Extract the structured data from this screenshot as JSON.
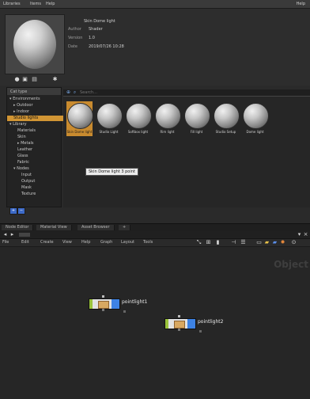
{
  "menu": [
    "Libraries",
    "Items",
    "Help"
  ],
  "menu_right": "Help",
  "info": {
    "title": "Skin Dome light",
    "rows": [
      {
        "k": "Author",
        "v": "Shader"
      },
      {
        "k": "Version",
        "v": "1.0"
      },
      {
        "k": "Date",
        "v": "2019/07/26 10:28"
      }
    ]
  },
  "left_panel": {
    "header": "Cat type",
    "items": [
      {
        "label": "Environments",
        "mk": "▾",
        "indent": 0,
        "selected": false
      },
      {
        "label": "Outdoor",
        "mk": "▸",
        "indent": 1,
        "selected": false
      },
      {
        "label": "Indoor",
        "mk": "▸",
        "indent": 1,
        "selected": false
      },
      {
        "label": "Studio lights",
        "mk": "",
        "indent": 1,
        "selected": true
      },
      {
        "label": "Library",
        "mk": "▾",
        "indent": 0,
        "selected": false
      },
      {
        "label": "Materials",
        "mk": "",
        "indent": 2,
        "selected": false
      },
      {
        "label": "Skin",
        "mk": "",
        "indent": 2,
        "selected": false
      },
      {
        "label": "Metals",
        "mk": "▸",
        "indent": 2,
        "selected": false
      },
      {
        "label": "Leather",
        "mk": "",
        "indent": 2,
        "selected": false
      },
      {
        "label": "Glass",
        "mk": "",
        "indent": 2,
        "selected": false
      },
      {
        "label": "Fabric",
        "mk": "",
        "indent": 2,
        "selected": false
      },
      {
        "label": "Nodes",
        "mk": "▾",
        "indent": 1,
        "selected": false
      },
      {
        "label": "Input",
        "mk": "",
        "indent": 3,
        "selected": false
      },
      {
        "label": "Output",
        "mk": "",
        "indent": 3,
        "selected": false
      },
      {
        "label": "Mask",
        "mk": "",
        "indent": 3,
        "selected": false
      },
      {
        "label": "Texture",
        "mk": "",
        "indent": 3,
        "selected": false
      }
    ]
  },
  "search": {
    "placeholder": "Search..."
  },
  "thumbnails": [
    {
      "label": "Skin Dome light",
      "selected": true
    },
    {
      "label": "Studio Light",
      "selected": false
    },
    {
      "label": "Softbox light",
      "selected": false
    },
    {
      "label": "Rim light",
      "selected": false
    },
    {
      "label": "Fill light",
      "selected": false
    },
    {
      "label": "Studio Setup",
      "selected": false
    },
    {
      "label": "Dome light",
      "selected": false
    }
  ],
  "tooltip": "Skin Dome light 3 point",
  "tabs": [
    "Node Editor",
    "Material View",
    "Asset Browser",
    "+"
  ],
  "node_toolbar": [
    "File",
    "Edit",
    "Create",
    "View",
    "Help",
    "Graph",
    "Layout",
    "Tools"
  ],
  "watermark": "Object",
  "nodes": [
    {
      "label": "pointlight1"
    },
    {
      "label": "pointlight2"
    }
  ],
  "colors": {
    "accent": "#d19534",
    "node_input": "#9ac33b",
    "node_output": "#3d82e4"
  }
}
